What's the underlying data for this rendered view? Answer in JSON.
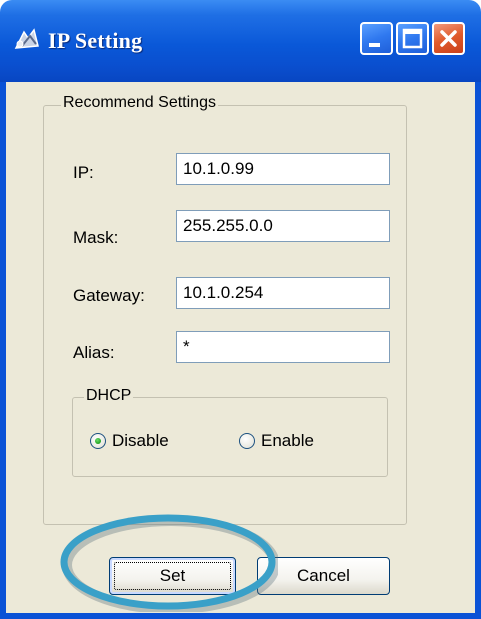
{
  "window": {
    "title": "IP Setting",
    "app_icon": "network-tool-icon",
    "controls": {
      "minimize": "minimize-icon",
      "maximize": "maximize-icon",
      "close": "close-icon"
    }
  },
  "settings_group": {
    "label": "Recommend Settings",
    "fields": {
      "ip": {
        "label": "IP:",
        "value": "10.1.0.99"
      },
      "mask": {
        "label": "Mask:",
        "value": "255.255.0.0"
      },
      "gateway": {
        "label": "Gateway:",
        "value": "10.1.0.254"
      },
      "alias": {
        "label": "Alias:",
        "value": "*"
      }
    },
    "dhcp": {
      "label": "DHCP",
      "options": [
        "Disable",
        "Enable"
      ],
      "selected": "Disable"
    }
  },
  "buttons": {
    "set": "Set",
    "cancel": "Cancel"
  },
  "colors": {
    "titlebar": "#0a58d8",
    "frame": "#0a52d6",
    "client_bg": "#ece9d8",
    "highlight": "#3aa0c8"
  }
}
